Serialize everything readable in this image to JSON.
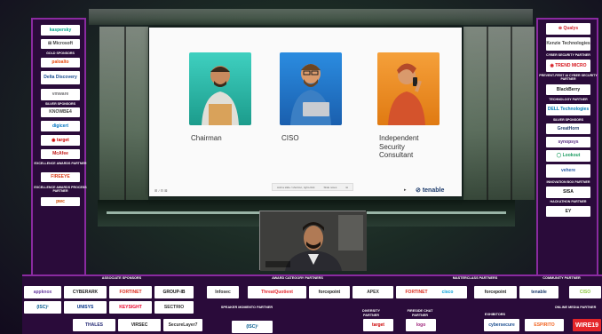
{
  "slide": {
    "roles": [
      "Chairman",
      "CISO",
      "Independent\nSecurity\nConsultant"
    ],
    "brand": "tenable",
    "brand_mark": "⊘",
    "footer_left": "⊞ / ⊟ ⊠",
    "toolbar": [
      "Add a slide / shortcut, right-click",
      "Slide notes",
      "⊞"
    ]
  },
  "left_panel": {
    "items": [
      {
        "type": "logo",
        "text": "kaspersky",
        "color": "#00a88e"
      },
      {
        "type": "logo",
        "text": "⊞ Microsoft",
        "color": "#444"
      },
      {
        "type": "label",
        "text": "GOLD SPONSORS"
      },
      {
        "type": "logo",
        "text": "paloalto",
        "color": "#e8490f"
      },
      {
        "type": "logo",
        "text": "Delta Discovery",
        "color": "#1a4d8f"
      },
      {
        "type": "logo",
        "text": "vmware",
        "color": "#717074"
      },
      {
        "type": "label",
        "text": "SILVER SPONSORS"
      },
      {
        "type": "logo",
        "text": "KNOWBE4",
        "color": "#444"
      },
      {
        "type": "logo",
        "text": "digicert",
        "color": "#0174c3"
      },
      {
        "type": "logo",
        "text": "◉ target",
        "color": "#cc0000"
      },
      {
        "type": "logo",
        "text": "McAfee",
        "color": "#c01818"
      },
      {
        "type": "label",
        "text": "EXCELLENCE AWARDS PARTNER"
      },
      {
        "type": "logo",
        "text": "FIREEYE",
        "color": "#d93c1a"
      },
      {
        "type": "label",
        "text": "EXCELLENCE AWARDS PROCESS PARTNER"
      },
      {
        "type": "logo",
        "text": "pwc",
        "color": "#d04a02"
      }
    ]
  },
  "right_panel": {
    "items": [
      {
        "type": "logo",
        "text": "⊕ Qualys",
        "color": "#d22630"
      },
      {
        "type": "logo",
        "text": "Kenzie Technologies",
        "color": "#444"
      },
      {
        "type": "label",
        "text": "CYBER SECURITY PARTNER"
      },
      {
        "type": "logo",
        "text": "◉ TREND MICRO",
        "color": "#d71920"
      },
      {
        "type": "label",
        "text": "PREVENT-FIRST AI CYBER SECURITY PARTNER"
      },
      {
        "type": "logo",
        "text": "BlackBerry",
        "color": "#222"
      },
      {
        "type": "label",
        "text": "TECHNOLOGY PARTNER"
      },
      {
        "type": "logo",
        "text": "DELL Technologies",
        "color": "#007db8"
      },
      {
        "type": "label",
        "text": "SILVER SPONSORS"
      },
      {
        "type": "logo",
        "text": "GreatHorn",
        "color": "#1f3b6b"
      },
      {
        "type": "logo",
        "text": "synopsys",
        "color": "#5a2d82"
      },
      {
        "type": "logo",
        "text": "◯ Lookout",
        "color": "#1a9b5f"
      },
      {
        "type": "logo",
        "text": "vehere",
        "color": "#2a5ca8"
      },
      {
        "type": "label",
        "text": "INNOVATION BOX PARTNER"
      },
      {
        "type": "logo",
        "text": "SISA",
        "color": "#111"
      },
      {
        "type": "label",
        "text": "HACKATHON PARTNER"
      },
      {
        "type": "logo",
        "text": "EY",
        "color": "#222"
      }
    ]
  },
  "bottom_bar": {
    "labels": [
      {
        "text": "ASSOCIATE SPONSORS"
      },
      {
        "text": "AWARD CATEGORY PARTNERS"
      },
      {
        "text": "MASTERCLASS PARTNERS"
      },
      {
        "text": "COMMUNITY PARTNER"
      },
      {
        "text": "SPEAKER MOMENTO PARTNER"
      },
      {
        "text": "DIVERSITY PARTNER"
      },
      {
        "text": "FIRESIDE CHAT PARTNER"
      },
      {
        "text": "EXHIBITORS"
      },
      {
        "text": "ONLINE MEDIA PARTNER"
      }
    ],
    "logos": [
      {
        "text": "appknox",
        "color": "#6a3ea1"
      },
      {
        "text": "CYBERARK",
        "color": "#222"
      },
      {
        "text": "FORTINET",
        "color": "#da291c"
      },
      {
        "text": "GROUP-IB",
        "color": "#111"
      },
      {
        "text": "(ISC)²",
        "color": "#00598e"
      },
      {
        "text": "UNISYS",
        "color": "#003087"
      },
      {
        "text": "KEYSIGHT",
        "color": "#e90029"
      },
      {
        "text": "SECTRIO",
        "color": "#333"
      },
      {
        "text": "THALES",
        "color": "#242a75"
      },
      {
        "text": "VIRSEC",
        "color": "#222"
      },
      {
        "text": "SecureLayer7",
        "color": "#333"
      },
      {
        "text": "Infosec",
        "color": "#333"
      },
      {
        "text": "ThreatQuotient",
        "color": "#e3262e"
      },
      {
        "text": "forcepoint",
        "color": "#222"
      },
      {
        "text": "APEX",
        "color": "#333"
      },
      {
        "text": "FORTINET",
        "color": "#da291c"
      },
      {
        "text": "cisco",
        "color": "#049fd9"
      },
      {
        "text": "forcepoint",
        "color": "#222"
      },
      {
        "text": "tenable",
        "color": "#1b3a6b"
      },
      {
        "text": "CISO",
        "color": "#8dc63f"
      },
      {
        "text": "(ISC)²",
        "color": "#00598e"
      },
      {
        "text": "target",
        "color": "#cc0000"
      },
      {
        "text": "logo",
        "color": "#a0287d"
      },
      {
        "text": "cybersecure",
        "color": "#1a4d8f"
      },
      {
        "text": "ESPIRITO",
        "color": "#f26522"
      },
      {
        "text": "WIRE19",
        "color": "#fff"
      }
    ]
  },
  "colors": {
    "panel_bg": "#2a0b3a",
    "panel_border": "#8a2aa0",
    "slide_bg": "#fafafa",
    "accent_teal": "#2fbfb0",
    "accent_blue": "#1e6fc9",
    "accent_orange": "#f08a1a"
  },
  "icons": [
    "chairman-avatar",
    "ciso-avatar",
    "consultant-avatar",
    "speaker-webcam"
  ]
}
